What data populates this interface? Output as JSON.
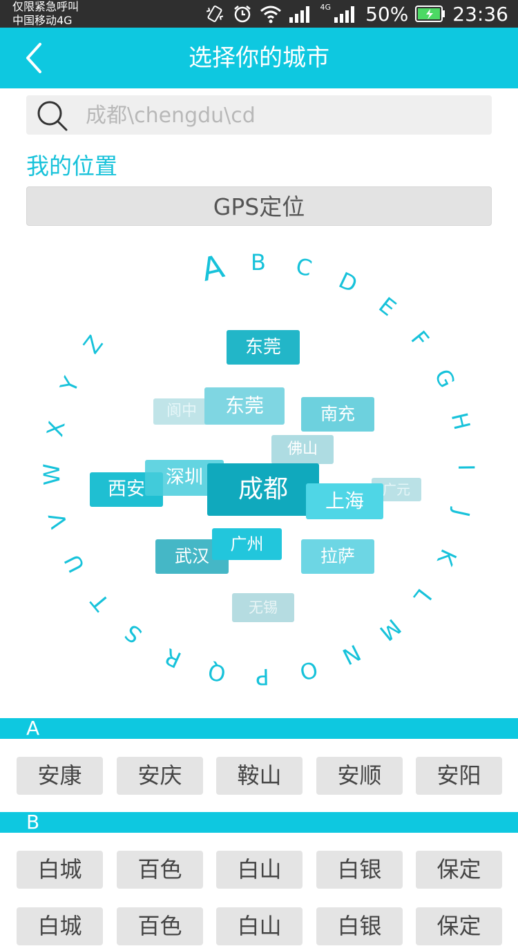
{
  "status_bar": {
    "carrier_line1": "仅限紧急呼叫",
    "carrier_line2": "中国移动4G",
    "network": "4G",
    "battery": "50%",
    "time": "23:36"
  },
  "header": {
    "title": "选择你的城市",
    "back_icon": "chevron-left-icon"
  },
  "search": {
    "placeholder": "成都\\chengdu\\cd",
    "value": ""
  },
  "location": {
    "label": "我的位置",
    "gps_button": "GPS定位"
  },
  "letter_wheel": {
    "letters": [
      "A",
      "B",
      "C",
      "D",
      "E",
      "F",
      "G",
      "H",
      "I",
      "J",
      "K",
      "L",
      "M",
      "N",
      "O",
      "P",
      "Q",
      "R",
      "S",
      "T",
      "U",
      "V",
      "W",
      "X",
      "Y",
      "Z"
    ],
    "selected": "A"
  },
  "tag_cloud": [
    {
      "name": "东莞"
    },
    {
      "name": "阆中"
    },
    {
      "name": "东莞"
    },
    {
      "name": "南充"
    },
    {
      "name": "佛山"
    },
    {
      "name": "西安"
    },
    {
      "name": "深圳"
    },
    {
      "name": "成都"
    },
    {
      "name": "广元"
    },
    {
      "name": "上海"
    },
    {
      "name": "武汉"
    },
    {
      "name": "广州"
    },
    {
      "name": "拉萨"
    },
    {
      "name": "无锡"
    }
  ],
  "sections": [
    {
      "letter": "A",
      "rows": [
        [
          "安康",
          "安庆",
          "鞍山",
          "安顺",
          "安阳"
        ]
      ]
    },
    {
      "letter": "B",
      "rows": [
        [
          "白城",
          "百色",
          "白山",
          "白银",
          "保定"
        ],
        [
          "白城",
          "百色",
          "白山",
          "白银",
          "保定"
        ]
      ]
    }
  ],
  "colors": {
    "accent": "#0ec8e0",
    "text_accent": "#17c2da"
  }
}
